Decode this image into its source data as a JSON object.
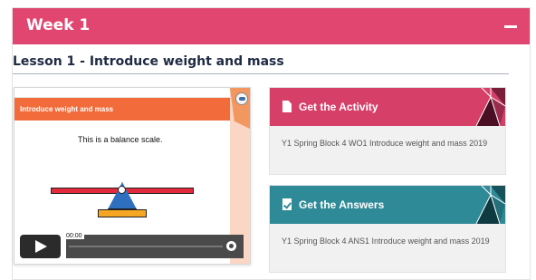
{
  "week": {
    "title": "Week 1",
    "collapse_icon": "minus-icon"
  },
  "lesson": {
    "title": "Lesson 1 - Introduce weight and mass"
  },
  "video": {
    "slide_banner": "Introduce weight and mass",
    "slide_text": "This is a balance scale.",
    "time": "00:00",
    "colors": {
      "banner": "#f26b3a",
      "beam": "#e32a3d",
      "fulcrum": "#2f6fbf",
      "base": "#f5a623"
    }
  },
  "activity": {
    "label": "Get the Activity",
    "icon": "document-icon",
    "description": "Y1 Spring Block 4 WO1 Introduce weight and mass 2019",
    "color": "#d63f68"
  },
  "answers": {
    "label": "Get the Answers",
    "icon": "check-document-icon",
    "description": "Y1 Spring Block 4 ANS1 Introduce weight and mass 2019",
    "color": "#2f8a97"
  }
}
